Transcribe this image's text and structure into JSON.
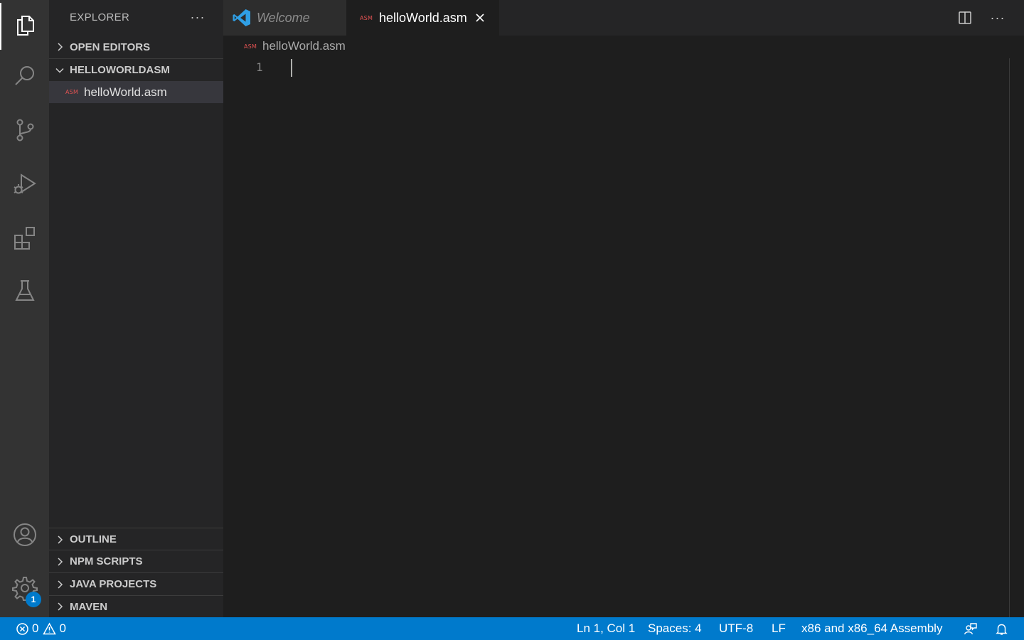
{
  "activity_bar": {
    "items": [
      {
        "name": "explorer",
        "icon": "files-icon",
        "active": true
      },
      {
        "name": "search",
        "icon": "search-icon"
      },
      {
        "name": "source-control",
        "icon": "source-control-icon"
      },
      {
        "name": "run-debug",
        "icon": "run-debug-icon"
      },
      {
        "name": "extensions",
        "icon": "extensions-icon"
      },
      {
        "name": "testing",
        "icon": "flask-icon"
      }
    ],
    "bottom": [
      {
        "name": "accounts",
        "icon": "account-icon"
      },
      {
        "name": "manage",
        "icon": "gear-icon",
        "badge": "1"
      }
    ]
  },
  "sidebar": {
    "title": "EXPLORER",
    "sections": {
      "open_editors": "OPEN EDITORS",
      "folder": "HELLOWORLDASM",
      "outline": "OUTLINE",
      "npm_scripts": "NPM SCRIPTS",
      "java_projects": "JAVA PROJECTS",
      "maven": "MAVEN"
    },
    "file": {
      "icon_text": "ASM",
      "name": "helloWorld.asm"
    }
  },
  "tabs": [
    {
      "label": "Welcome",
      "icon": "vscode-icon",
      "active": false
    },
    {
      "label": "helloWorld.asm",
      "icon_text": "ASM",
      "active": true
    }
  ],
  "breadcrumb": {
    "icon_text": "ASM",
    "label": "helloWorld.asm"
  },
  "editor": {
    "line_numbers": [
      "1"
    ],
    "content": ""
  },
  "status_bar": {
    "errors": "0",
    "warnings": "0",
    "position": "Ln 1, Col 1",
    "spaces": "Spaces: 4",
    "encoding": "UTF-8",
    "eol": "LF",
    "language": "x86 and x86_64 Assembly"
  },
  "colors": {
    "status_bar": "#007acc",
    "asm_icon": "#e05252",
    "vscode_blue": "#2f9fe5"
  }
}
